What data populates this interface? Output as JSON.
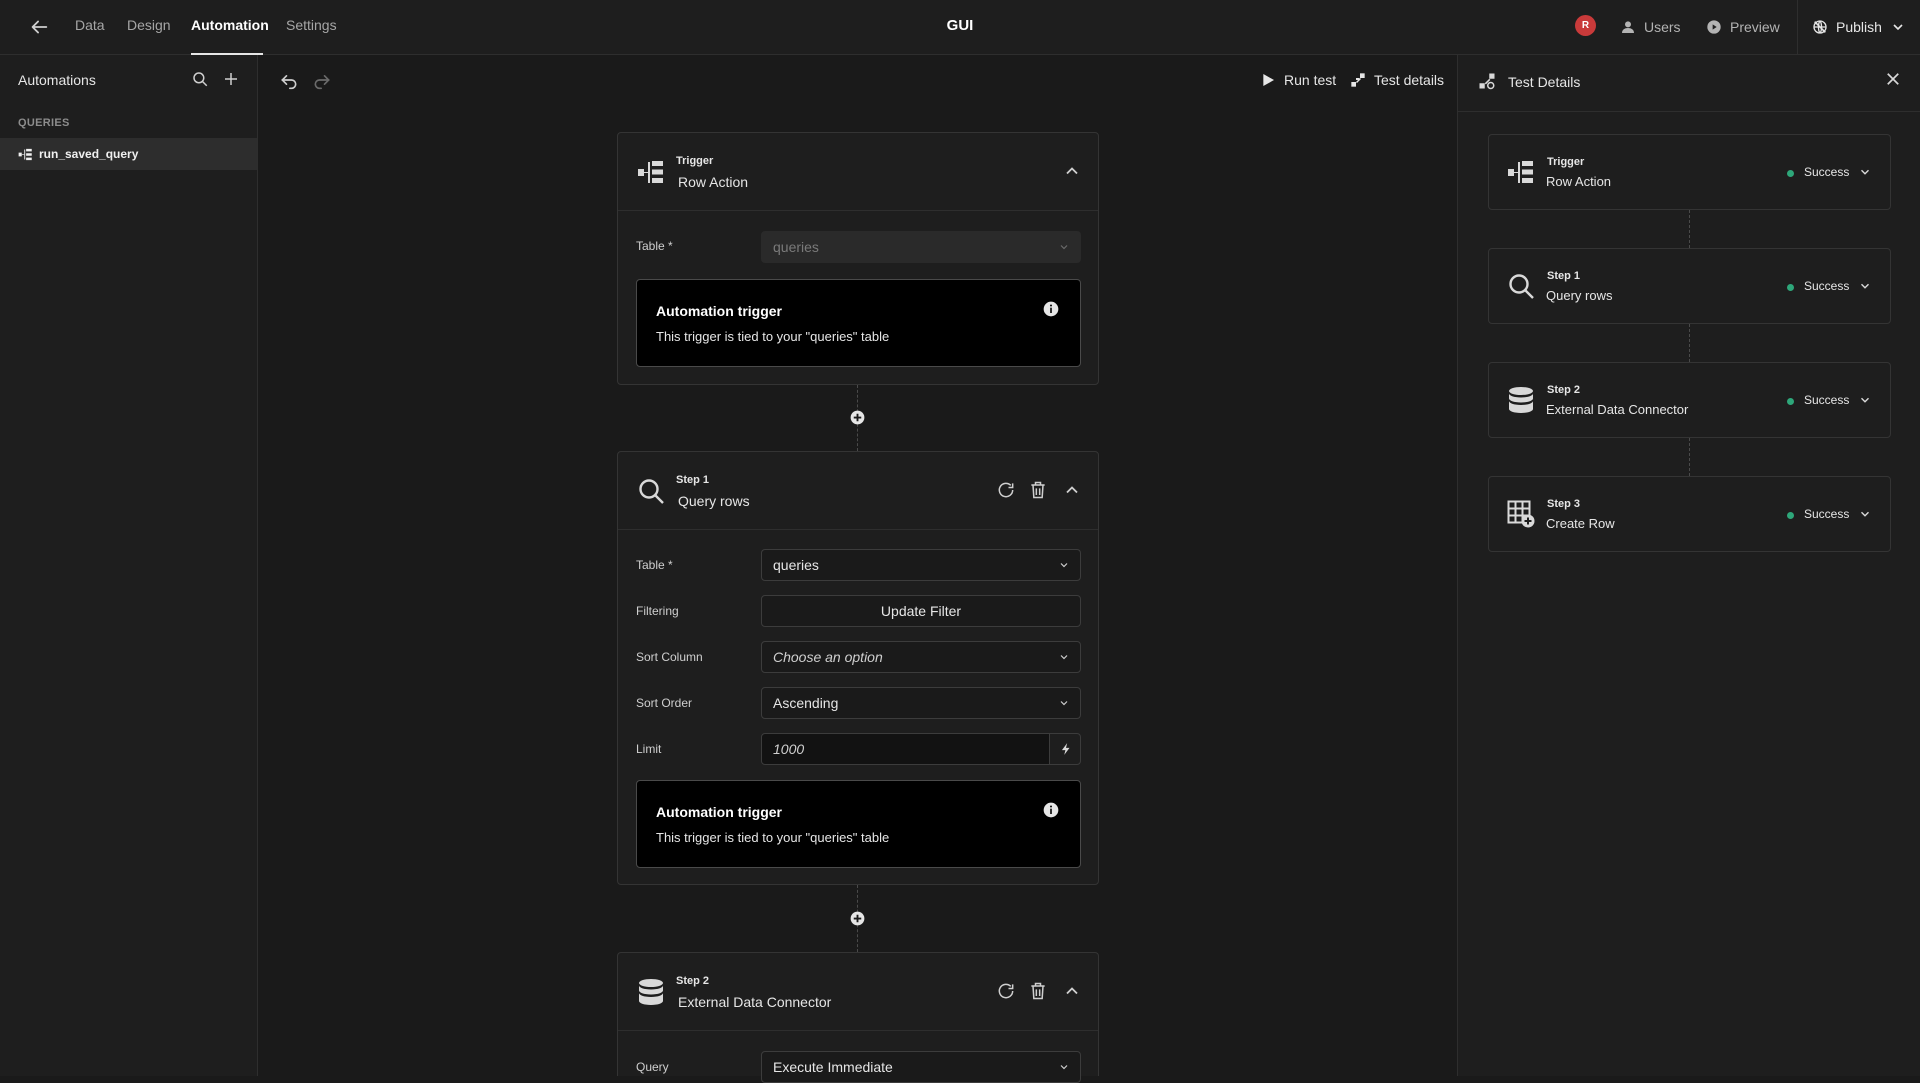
{
  "topbar": {
    "tabs": [
      "Data",
      "Design",
      "Automation",
      "Settings"
    ],
    "active_tab": "Automation",
    "title": "GUI",
    "avatar_initial": "R",
    "users_label": "Users",
    "preview_label": "Preview",
    "publish_label": "Publish"
  },
  "sidebar": {
    "title": "Automations",
    "section_label": "QUERIES",
    "items": [
      {
        "label": "run_saved_query",
        "selected": true
      }
    ]
  },
  "toolbar": {
    "run_test_label": "Run test",
    "test_details_label": "Test details"
  },
  "blocks": {
    "trigger": {
      "kicker": "Trigger",
      "name": "Row Action",
      "icon": "row-action-icon",
      "table_label": "Table *",
      "table_value": "queries",
      "notice_title": "Automation trigger",
      "notice_body": "This trigger is tied to your \"queries\" table"
    },
    "step1": {
      "kicker": "Step 1",
      "name": "Query rows",
      "icon": "search-icon",
      "table_label": "Table *",
      "table_value": "queries",
      "filtering_label": "Filtering",
      "filter_button": "Update Filter",
      "sort_column_label": "Sort Column",
      "sort_column_placeholder": "Choose an option",
      "sort_order_label": "Sort Order",
      "sort_order_value": "Ascending",
      "limit_label": "Limit",
      "limit_value": "1000",
      "notice_title": "Automation trigger",
      "notice_body": "This trigger is tied to your \"queries\" table"
    },
    "step2": {
      "kicker": "Step 2",
      "name": "External Data Connector",
      "icon": "database-icon",
      "query_label": "Query",
      "query_value": "Execute Immediate"
    }
  },
  "test_details": {
    "title": "Test Details",
    "steps": [
      {
        "kicker": "Trigger",
        "name": "Row Action",
        "status": "Success",
        "icon": "row-action-icon"
      },
      {
        "kicker": "Step 1",
        "name": "Query rows",
        "status": "Success",
        "icon": "search-icon"
      },
      {
        "kicker": "Step 2",
        "name": "External Data Connector",
        "status": "Success",
        "icon": "database-icon"
      },
      {
        "kicker": "Step 3",
        "name": "Create Row",
        "status": "Success",
        "icon": "create-row-icon"
      }
    ],
    "success_color": "#2ea77a"
  }
}
